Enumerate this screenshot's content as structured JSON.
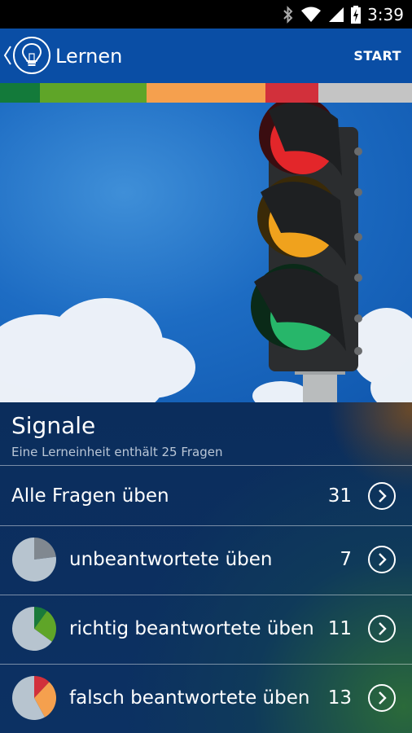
{
  "status_bar": {
    "time": "3:39",
    "icons": [
      "bluetooth-icon",
      "wifi-icon",
      "cell-signal-icon",
      "battery-charging-icon"
    ]
  },
  "action_bar": {
    "title": "Lernen",
    "start_label": "START",
    "color": "#0a4ea5"
  },
  "progress_strip": [
    {
      "color": "#137a3a",
      "fraction": 0.097
    },
    {
      "color": "#5fa528",
      "fraction": 0.259
    },
    {
      "color": "#f5a04e",
      "fraction": 0.289
    },
    {
      "color": "#d2303b",
      "fraction": 0.128
    },
    {
      "color": "#c4c4c4",
      "fraction": 0.227
    }
  ],
  "hero": {
    "subject": "traffic-light-image"
  },
  "section": {
    "title": "Signale",
    "subtitle": "Eine Lerneinheit enthält 25 Fragen"
  },
  "rows": [
    {
      "label": "Alle Fragen üben",
      "count": "31"
    },
    {
      "label": "unbeantwortete üben",
      "count": "7",
      "pie": [
        {
          "color": "#808890",
          "fraction": 0.23
        },
        {
          "color": "#b7c4cf",
          "fraction": 0.77
        }
      ]
    },
    {
      "label": "richtig beantwortete üben",
      "count": "11",
      "pie": [
        {
          "color": "#1a7a3a",
          "fraction": 0.1
        },
        {
          "color": "#5fa528",
          "fraction": 0.25
        },
        {
          "color": "#b7c4cf",
          "fraction": 0.65
        }
      ]
    },
    {
      "label": "falsch beantwortete üben",
      "count": "13",
      "pie": [
        {
          "color": "#d2303b",
          "fraction": 0.12
        },
        {
          "color": "#f5a04e",
          "fraction": 0.3
        },
        {
          "color": "#b7c4cf",
          "fraction": 0.58
        }
      ]
    }
  ]
}
